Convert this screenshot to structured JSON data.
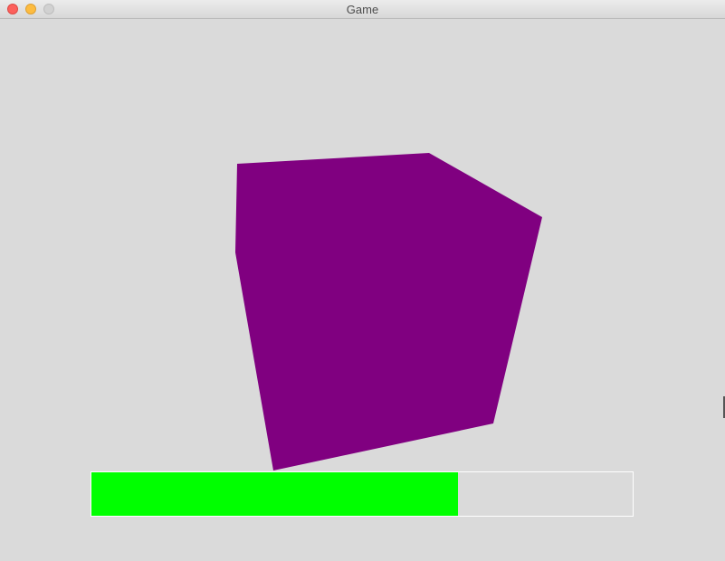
{
  "window": {
    "title": "Game"
  },
  "scene": {
    "shape_color": "#800080",
    "background_color": "#dadada"
  },
  "progress_bar": {
    "fill_fraction": 0.677,
    "fill_color": "#00ff00",
    "border_color": "#ffffff"
  }
}
